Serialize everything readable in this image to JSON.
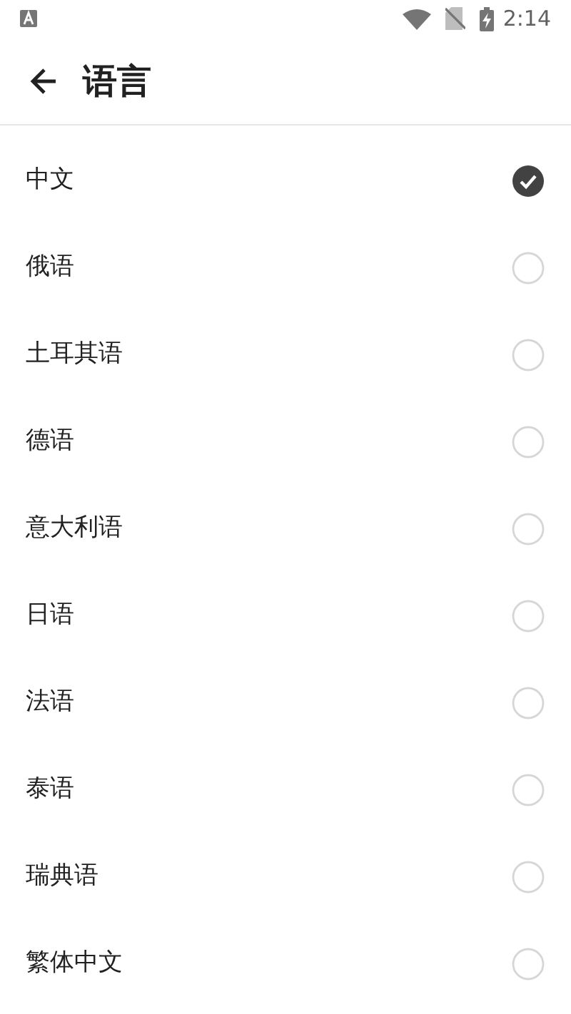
{
  "status_bar": {
    "time": "2:14"
  },
  "header": {
    "title": "语言"
  },
  "languages": [
    {
      "label": "中文",
      "selected": true
    },
    {
      "label": "俄语",
      "selected": false
    },
    {
      "label": "土耳其语",
      "selected": false
    },
    {
      "label": "德语",
      "selected": false
    },
    {
      "label": "意大利语",
      "selected": false
    },
    {
      "label": "日语",
      "selected": false
    },
    {
      "label": "法语",
      "selected": false
    },
    {
      "label": "泰语",
      "selected": false
    },
    {
      "label": "瑞典语",
      "selected": false
    },
    {
      "label": "繁体中文",
      "selected": false
    }
  ]
}
